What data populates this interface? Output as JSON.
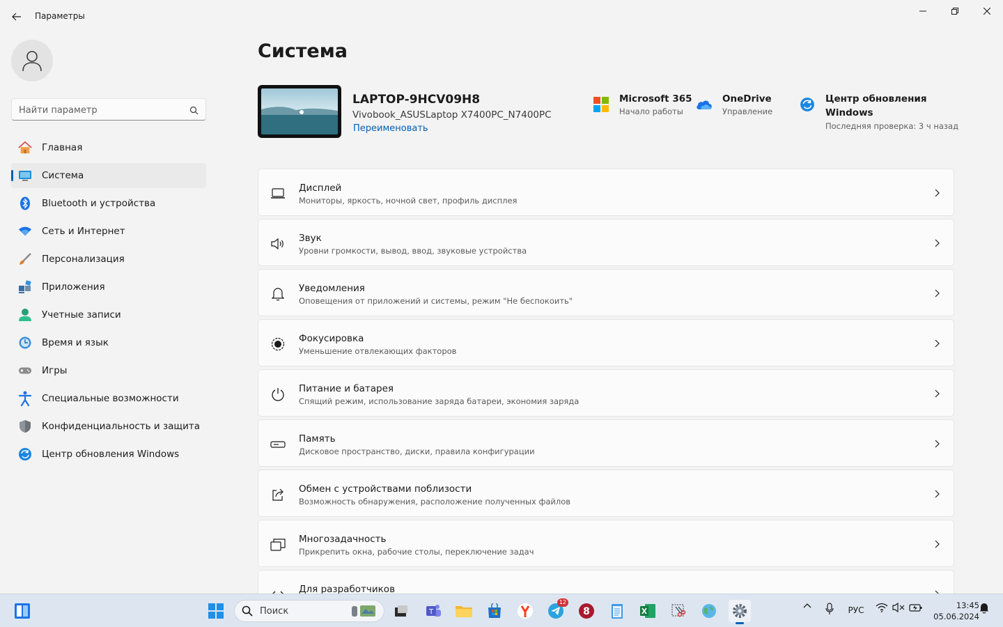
{
  "window": {
    "title": "Параметры"
  },
  "search": {
    "placeholder": "Найти параметр"
  },
  "sidebar": {
    "items": [
      {
        "label": "Главная",
        "icon": "home-icon"
      },
      {
        "label": "Система",
        "icon": "system-icon",
        "active": true
      },
      {
        "label": "Bluetooth и устройства",
        "icon": "bluetooth-icon"
      },
      {
        "label": "Сеть и Интернет",
        "icon": "wifi-icon"
      },
      {
        "label": "Персонализация",
        "icon": "brush-icon"
      },
      {
        "label": "Приложения",
        "icon": "apps-icon"
      },
      {
        "label": "Учетные записи",
        "icon": "account-icon"
      },
      {
        "label": "Время и язык",
        "icon": "time-language-icon"
      },
      {
        "label": "Игры",
        "icon": "gamepad-icon"
      },
      {
        "label": "Специальные возможности",
        "icon": "accessibility-icon"
      },
      {
        "label": "Конфиденциальность и защита",
        "icon": "shield-icon"
      },
      {
        "label": "Центр обновления Windows",
        "icon": "windows-update-icon"
      }
    ]
  },
  "main": {
    "title": "Система",
    "device": {
      "name": "LAPTOP-9HCV09H8",
      "model": "Vivobook_ASUSLaptop X7400PC_N7400PC",
      "rename": "Переименовать"
    },
    "quick": [
      {
        "title": "Microsoft 365",
        "sub": "Начало работы",
        "icon": "microsoft-365-icon"
      },
      {
        "title": "OneDrive",
        "sub": "Управление",
        "icon": "onedrive-icon"
      },
      {
        "title": "Центр обновления Windows",
        "sub": "Последняя проверка: 3 ч назад",
        "icon": "windows-update-icon"
      }
    ],
    "cards": [
      {
        "title": "Дисплей",
        "sub": "Мониторы, яркость, ночной свет, профиль дисплея",
        "icon": "display-icon"
      },
      {
        "title": "Звук",
        "sub": "Уровни громкости, вывод, ввод, звуковые устройства",
        "icon": "speaker-icon"
      },
      {
        "title": "Уведомления",
        "sub": "Оповещения от приложений и системы, режим \"Не беспокоить\"",
        "icon": "bell-icon"
      },
      {
        "title": "Фокусировка",
        "sub": "Уменьшение отвлекающих факторов",
        "icon": "focus-icon"
      },
      {
        "title": "Питание и батарея",
        "sub": "Спящий режим, использование заряда батареи, экономия заряда",
        "icon": "power-icon"
      },
      {
        "title": "Память",
        "sub": "Дисковое пространство, диски, правила конфигурации",
        "icon": "storage-icon"
      },
      {
        "title": "Обмен с устройствами поблизости",
        "sub": "Возможность обнаружения, расположение полученных файлов",
        "icon": "share-icon"
      },
      {
        "title": "Многозадачность",
        "sub": "Прикрепить окна, рабочие столы, переключение задач",
        "icon": "multitasking-icon"
      },
      {
        "title": "Для разработчиков",
        "sub": "",
        "icon": "developer-icon"
      }
    ]
  },
  "taskbar": {
    "search_label": "Поиск",
    "telegram_badge": "12",
    "language": "РУС",
    "time": "13:45",
    "date": "05.06.2024"
  },
  "colors": {
    "accent": "#005fb8",
    "taskbar": "#dde6f0",
    "background": "#f3f3f3"
  }
}
